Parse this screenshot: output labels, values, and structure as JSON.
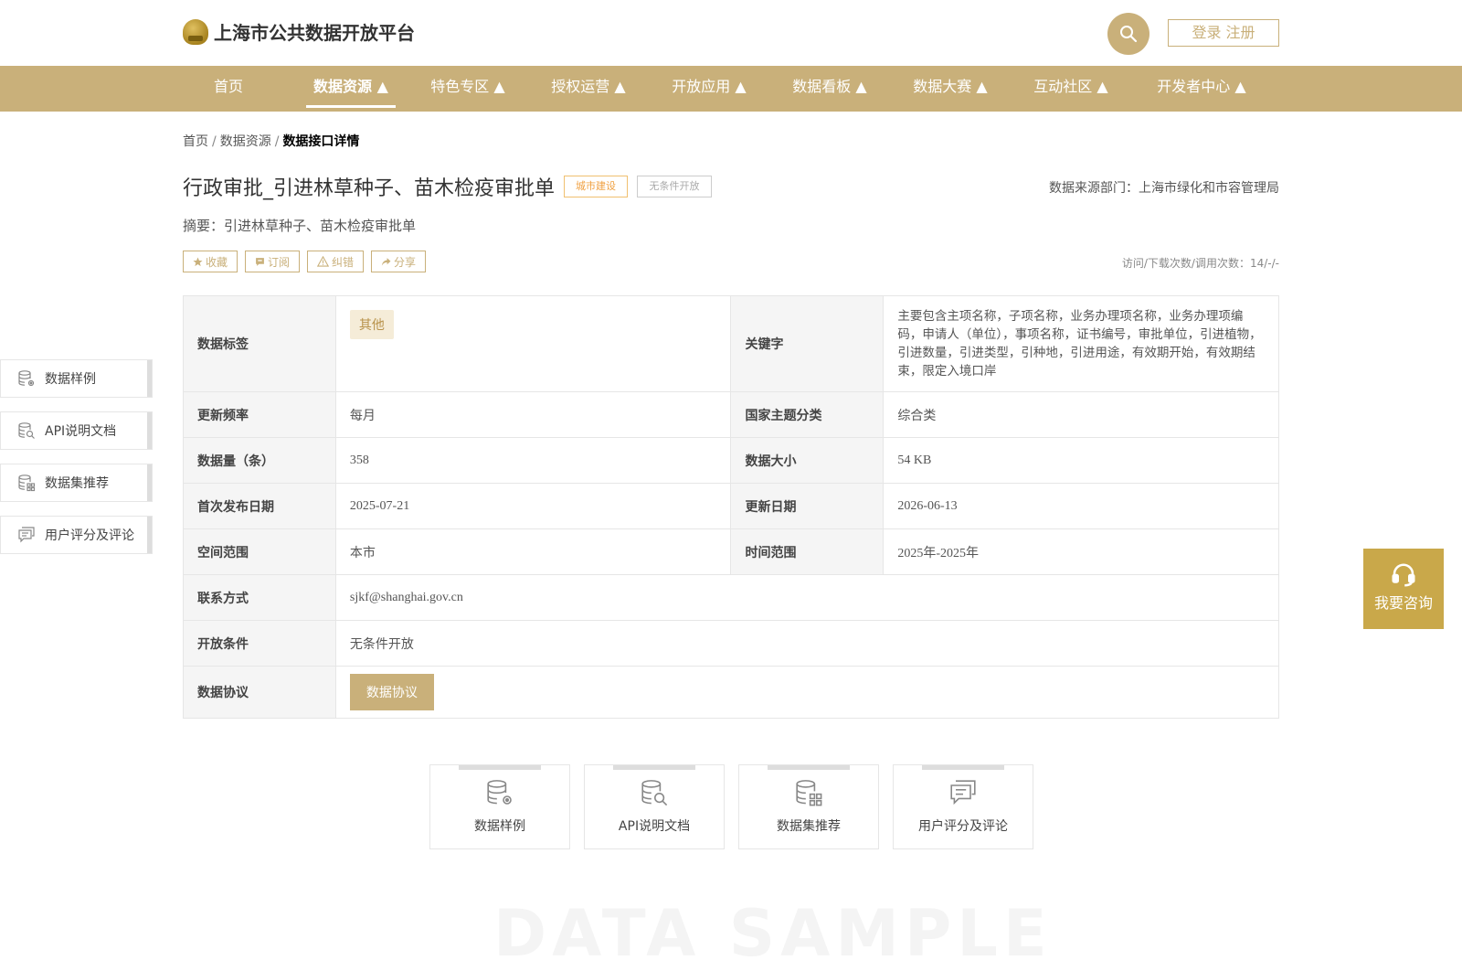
{
  "header": {
    "site_title": "上海市公共数据开放平台",
    "login_label": "登录 注册"
  },
  "nav": [
    {
      "label": "首页"
    },
    {
      "label": "数据资源 ▲"
    },
    {
      "label": "特色专区 ▲"
    },
    {
      "label": "授权运营 ▲"
    },
    {
      "label": "开放应用 ▲"
    },
    {
      "label": "数据看板 ▲"
    },
    {
      "label": "数据大赛 ▲"
    },
    {
      "label": "互动社区 ▲"
    },
    {
      "label": "开发者中心 ▲"
    }
  ],
  "breadcrumb": {
    "home": "首页",
    "sep": "/",
    "section": "数据资源",
    "current": "数据接口详情"
  },
  "detail": {
    "title": "行政审批_引进林草种子、苗木检疫审批单",
    "tag_category": "城市建设",
    "tag_open": "无条件开放",
    "source": "数据来源部门：上海市绿化和市容管理局",
    "summary": "摘要：引进林草种子、苗木检疫审批单",
    "visits": "访问/下载次数/调用次数：14/-/-"
  },
  "actions": {
    "favorite": "收藏",
    "subscribe": "订阅",
    "report": "纠错",
    "share": "分享"
  },
  "table": {
    "data_tag_label": "数据标签",
    "data_tag_chip": "其他",
    "keywords_label": "关键字",
    "keywords_value": "主要包含主项名称，子项名称，业务办理项名称，业务办理项编码，申请人（单位），事项名称，证书编号，审批单位，引进植物，引进数量，引进类型，引种地，引进用途，有效期开始，有效期结束，限定入境口岸",
    "freq_label": "更新频率",
    "freq_value": "每月",
    "theme_label": "国家主题分类",
    "theme_value": "综合类",
    "count_label": "数据量（条）",
    "count_value": "358",
    "size_label": "数据大小",
    "size_value": "54 KB",
    "first_date_label": "首次发布日期",
    "first_date_value": "2025-07-21",
    "update_date_label": "更新日期",
    "update_date_value": "2026-06-13",
    "space_label": "空间范围",
    "space_value": "本市",
    "time_label": "时间范围",
    "time_value": "2025年-2025年",
    "contact_label": "联系方式",
    "contact_value": "sjkf@shanghai.gov.cn",
    "open_cond_label": "开放条件",
    "open_cond_value": "无条件开放",
    "protocol_label": "数据协议",
    "protocol_button": "数据协议"
  },
  "side_nav": [
    {
      "label": "数据样例",
      "icon": "database-gear-icon"
    },
    {
      "label": "API说明文档",
      "icon": "database-search-icon"
    },
    {
      "label": "数据集推荐",
      "icon": "database-grid-icon"
    },
    {
      "label": "用户评分及评论",
      "icon": "comment-icon"
    }
  ],
  "cards": [
    {
      "label": "数据样例",
      "icon": "database-gear-icon"
    },
    {
      "label": "API说明文档",
      "icon": "database-search-icon"
    },
    {
      "label": "数据集推荐",
      "icon": "database-grid-icon"
    },
    {
      "label": "用户评分及评论",
      "icon": "comment-icon"
    }
  ],
  "consult": {
    "label": "我要咨询"
  },
  "watermark": "DATA SAMPLE",
  "colors": {
    "accent": "#c9b07a",
    "consult": "#c9a84a",
    "tag_orange": "#f0a040"
  }
}
